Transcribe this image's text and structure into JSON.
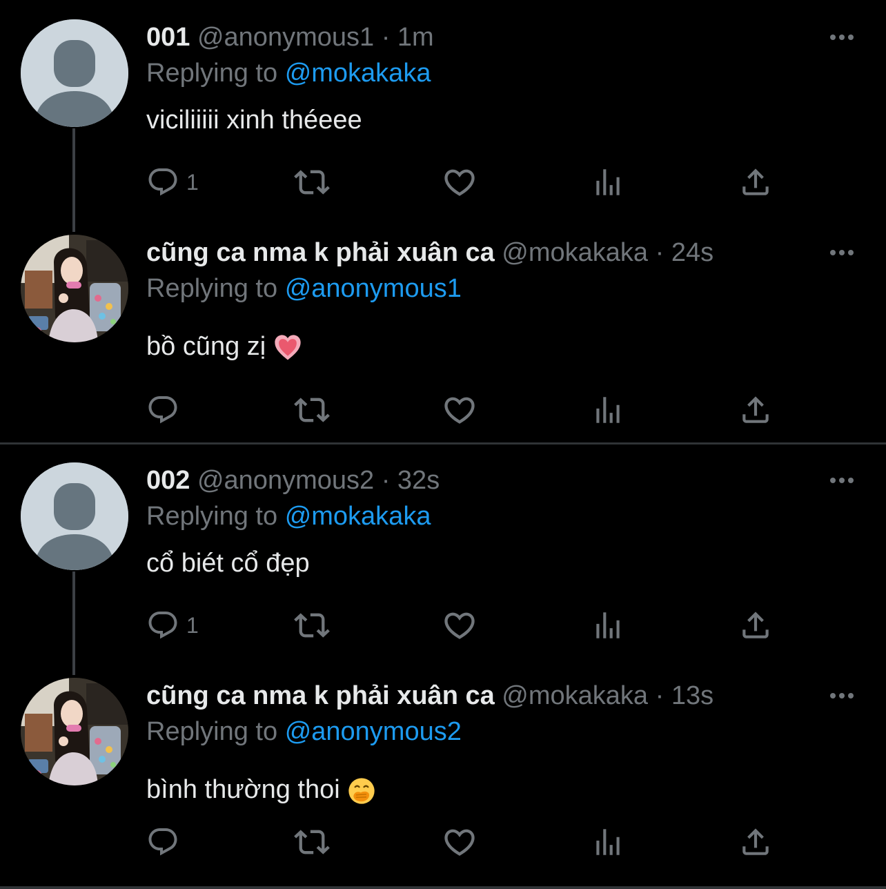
{
  "threads": [
    {
      "tweets": [
        {
          "display_name": "001",
          "handle": "@anonymous1",
          "separator": "·",
          "time": "1m",
          "replying_prefix": "Replying to",
          "replying_to": "@mokakaka",
          "text": "viciliiiii xinh théeee",
          "avatar": "default-avatar",
          "reply_count": "1"
        },
        {
          "display_name": "cũng ca nma k phải xuân ca",
          "handle": "@mokakaka",
          "separator": "·",
          "time": "24s",
          "replying_prefix": "Replying to",
          "replying_to": "@anonymous1",
          "text": "bồ cũng zị",
          "emoji": "pink-heart-emoji",
          "avatar": "profile-photo",
          "reply_count": ""
        }
      ]
    },
    {
      "tweets": [
        {
          "display_name": "002",
          "handle": "@anonymous2",
          "separator": "·",
          "time": "32s",
          "replying_prefix": "Replying to",
          "replying_to": "@mokakaka",
          "text": "cổ biét cổ đẹp",
          "avatar": "default-avatar",
          "reply_count": "1"
        },
        {
          "display_name": "cũng ca nma k phải xuân ca",
          "handle": "@mokakaka",
          "separator": "·",
          "time": "13s",
          "replying_prefix": "Replying to",
          "replying_to": "@anonymous2",
          "text": "bình thường thoi",
          "emoji": "hand-over-mouth-emoji",
          "avatar": "profile-photo",
          "reply_count": ""
        }
      ]
    }
  ],
  "icons": [
    "reply-icon",
    "retweet-icon",
    "like-icon",
    "analytics-icon",
    "share-icon",
    "more-icon"
  ],
  "colors": {
    "background": "#000000",
    "text": "#e7e9ea",
    "secondary": "#71767b",
    "link": "#1d9bf0",
    "divider": "#2f3336"
  }
}
